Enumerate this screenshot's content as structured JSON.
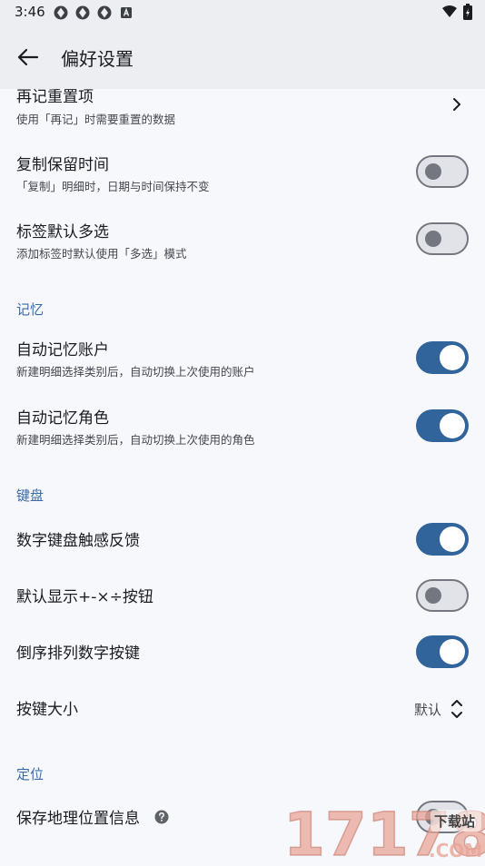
{
  "status_bar": {
    "time": "3:46"
  },
  "app_bar": {
    "title": "偏好设置"
  },
  "rows": {
    "reset_items": {
      "title": "再记重置项",
      "subtitle": "使用「再记」时需要重置的数据"
    },
    "copy_keep_time": {
      "title": "复制保留时间",
      "subtitle": "「复制」明细时，日期与时间保持不变",
      "on": false
    },
    "tag_multi": {
      "title": "标签默认多选",
      "subtitle": "添加标签时默认使用「多选」模式",
      "on": false
    },
    "remember_account": {
      "title": "自动记忆账户",
      "subtitle": "新建明细选择类别后，自动切换上次使用的账户",
      "on": true
    },
    "remember_role": {
      "title": "自动记忆角色",
      "subtitle": "新建明细选择类别后，自动切换上次使用的角色",
      "on": true
    },
    "haptic": {
      "title": "数字键盘触感反馈",
      "on": true
    },
    "show_ops": {
      "title": "默认显示+-×÷按钮",
      "on": false
    },
    "reverse_keys": {
      "title": "倒序排列数字按键",
      "on": true
    },
    "key_size": {
      "title": "按键大小",
      "value": "默认"
    },
    "save_location": {
      "title": "保存地理位置信息",
      "on": false
    }
  },
  "sections": {
    "memory": "记忆",
    "keyboard": "键盘",
    "location": "定位"
  },
  "watermark": {
    "text": "17178",
    "badge": "下载站",
    "domain": ".COM"
  },
  "colors": {
    "accent": "#31649b",
    "section": "#3a6aa8",
    "surface": "#f7f8fc",
    "appbar": "#eceef2"
  }
}
